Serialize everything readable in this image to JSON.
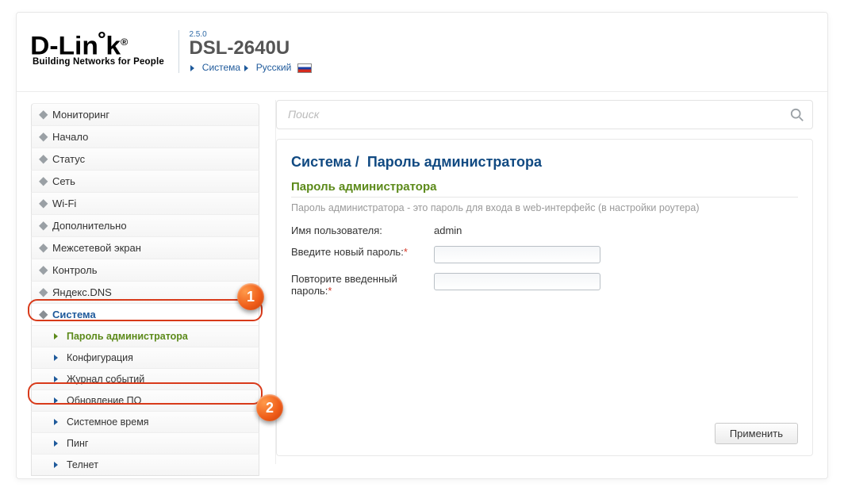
{
  "header": {
    "brand_prefix": "D-Lin",
    "brand_suffix": "k",
    "tagline": "Building Networks for People",
    "version": "2.5.0",
    "model": "DSL-2640U",
    "crumb1": "Система",
    "crumb2": "Русский"
  },
  "search": {
    "placeholder": "Поиск"
  },
  "sidebar": {
    "items": [
      {
        "label": "Мониторинг"
      },
      {
        "label": "Начало"
      },
      {
        "label": "Статус"
      },
      {
        "label": "Сеть"
      },
      {
        "label": "Wi-Fi"
      },
      {
        "label": "Дополнительно"
      },
      {
        "label": "Межсетевой экран"
      },
      {
        "label": "Контроль"
      },
      {
        "label": "Яндекс.DNS"
      },
      {
        "label": "Система"
      }
    ],
    "sub": [
      {
        "label": "Пароль администратора"
      },
      {
        "label": "Конфигурация"
      },
      {
        "label": "Журнал событий"
      },
      {
        "label": "Обновление ПО"
      },
      {
        "label": "Системное время"
      },
      {
        "label": "Пинг"
      },
      {
        "label": "Телнет"
      }
    ]
  },
  "annotations": {
    "one": "1",
    "two": "2"
  },
  "page": {
    "title_a": "Система",
    "title_sep": "/",
    "title_b": "Пароль администратора",
    "section_title": "Пароль администратора",
    "section_desc": "Пароль администратора - это пароль для входа в web-интерфейс (в настройки роутера)",
    "username_label": "Имя пользователя:",
    "username_value": "admin",
    "newpass_label": "Введите новый пароль:",
    "confirm_label": "Повторите введенный пароль:",
    "required_mark": "*",
    "apply": "Применить"
  }
}
